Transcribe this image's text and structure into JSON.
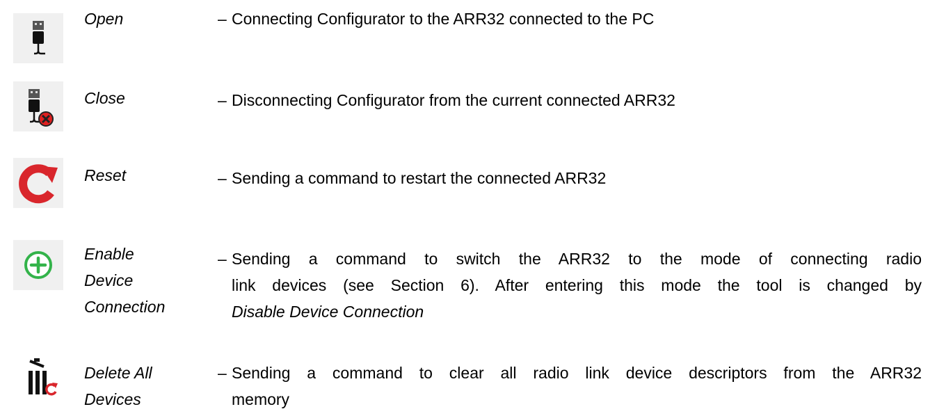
{
  "tools": [
    {
      "icon": "usb-plug-icon",
      "name_lines": [
        "Open"
      ],
      "dash": "–",
      "desc_lines": [
        "Connecting Configurator to the ARR32 connected to the PC"
      ]
    },
    {
      "icon": "usb-plug-disconnect-icon",
      "name_lines": [
        "Close"
      ],
      "dash": "–",
      "desc_lines": [
        "Disconnecting Configurator from the current connected ARR32"
      ]
    },
    {
      "icon": "reset-arrow-icon",
      "name_lines": [
        "Reset"
      ],
      "dash": "–",
      "desc_lines": [
        "Sending a command to restart the connected ARR32"
      ]
    },
    {
      "icon": "plus-circle-icon",
      "name_lines": [
        "Enable",
        "Device",
        "Connection"
      ],
      "dash": "–",
      "desc_lines": [
        "Sending a command to switch the ARR32 to the mode of connecting radio",
        "link devices (see Section 6). After entering this mode the tool is changed by"
      ],
      "desc_italic_line": "Disable Device Connection"
    },
    {
      "icon": "trash-refresh-icon",
      "name_lines": [
        "Delete All",
        "Devices"
      ],
      "dash": "–",
      "desc_lines": [
        "Sending a command to clear all radio link device descriptors from the ARR32",
        "memory"
      ]
    }
  ],
  "colors": {
    "reset_red": "#d9262c",
    "plus_green": "#33b34a",
    "close_x_red": "#e02020",
    "icon_bg": "#f0f0f0"
  }
}
